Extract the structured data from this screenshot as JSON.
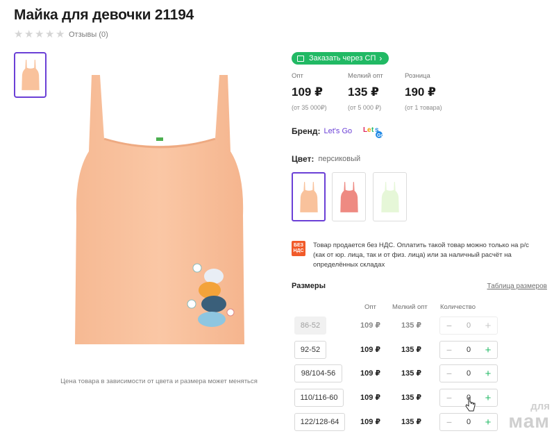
{
  "product": {
    "title": "Майка для девочки 21194",
    "reviews": "Отзывы (0)",
    "stars": 0,
    "caption": "Цена товара в зависимости от цвета и размера может меняться"
  },
  "order_button": {
    "label": "Заказать через СП"
  },
  "prices": [
    {
      "label": "Опт",
      "value": "109 ₽",
      "note": "(от 35 000₽)"
    },
    {
      "label": "Мелкий опт",
      "value": "135 ₽",
      "note": "(от 5 000 ₽)"
    },
    {
      "label": "Розница",
      "value": "190 ₽",
      "note": "(от 1 товара)"
    }
  ],
  "brand": {
    "title": "Бренд:",
    "link": "Let's Go",
    "logo_text": "Let's Go"
  },
  "color": {
    "title": "Цвет:",
    "value": "персиковый",
    "swatches": [
      "#f9c29c",
      "#ee8a82",
      "#e6f7d8"
    ]
  },
  "vat": {
    "badge_line1": "БЕЗ",
    "badge_line2": "НДС",
    "text": "Товар продается без НДС. Оплатить такой товар можно только на р/с (как от юр. лица, так и от физ. лица) или за наличный расчёт на определённых складах"
  },
  "sizes": {
    "title": "Размеры",
    "table_link": "Таблица размеров",
    "headers": {
      "opt": "Опт",
      "small_opt": "Мелкий опт",
      "quantity": "Количество"
    },
    "rows": [
      {
        "size": "86-52",
        "opt": "109 ₽",
        "small_opt": "135 ₽",
        "qty": "0",
        "available": false
      },
      {
        "size": "92-52",
        "opt": "109 ₽",
        "small_opt": "135 ₽",
        "qty": "0",
        "available": true
      },
      {
        "size": "98/104-56",
        "opt": "109 ₽",
        "small_opt": "135 ₽",
        "qty": "0",
        "available": true
      },
      {
        "size": "110/116-60",
        "opt": "109 ₽",
        "small_opt": "135 ₽",
        "qty": "0",
        "available": true
      },
      {
        "size": "122/128-64",
        "opt": "109 ₽",
        "small_opt": "135 ₽",
        "qty": "0",
        "available": true
      }
    ]
  },
  "watermark": {
    "line1": "для",
    "line2": "мам"
  },
  "colors": {
    "accent": "#6a3fd6",
    "green": "#21b964",
    "vat": "#f15a29"
  }
}
